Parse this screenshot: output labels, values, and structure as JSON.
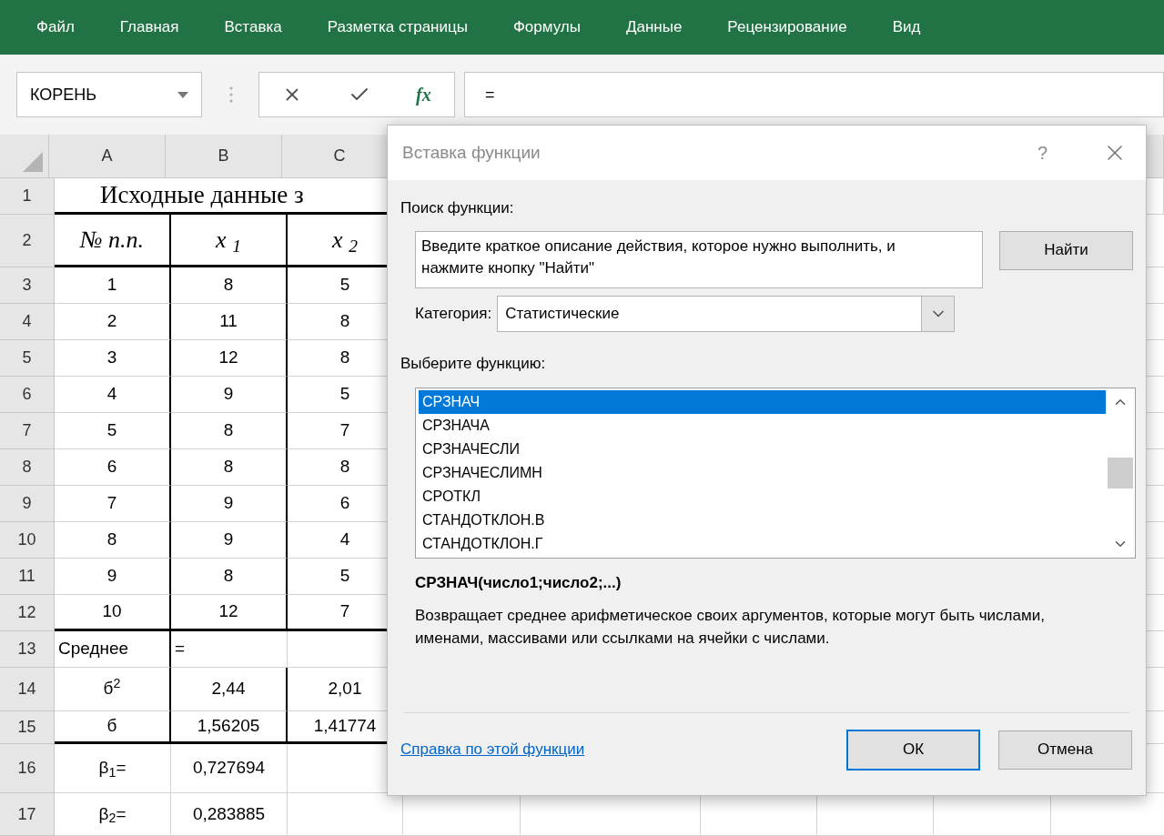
{
  "ribbon_tabs": [
    {
      "label": "Файл"
    },
    {
      "label": "Главная"
    },
    {
      "label": "Вставка"
    },
    {
      "label": "Разметка страницы"
    },
    {
      "label": "Формулы"
    },
    {
      "label": "Данные"
    },
    {
      "label": "Рецензирование"
    },
    {
      "label": "Вид"
    }
  ],
  "formula_bar": {
    "name_box": "КОРЕНЬ",
    "function_button": "fx",
    "formula": "="
  },
  "sheet": {
    "columns": [
      "A",
      "B",
      "C"
    ],
    "rows": [
      {
        "number": "1",
        "kind": "title",
        "title": "Исходные данные з"
      },
      {
        "number": "2",
        "kind": "header",
        "cells": {
          "A": "№ п.п.",
          "B": "x $_{1}$",
          "C": "x $_{2}$"
        }
      },
      {
        "number": "3",
        "kind": "data",
        "cells": {
          "A": "1",
          "B": "8",
          "C": "5"
        }
      },
      {
        "number": "4",
        "kind": "data",
        "cells": {
          "A": "2",
          "B": "11",
          "C": "8"
        }
      },
      {
        "number": "5",
        "kind": "data",
        "cells": {
          "A": "3",
          "B": "12",
          "C": "8"
        }
      },
      {
        "number": "6",
        "kind": "data",
        "cells": {
          "A": "4",
          "B": "9",
          "C": "5"
        }
      },
      {
        "number": "7",
        "kind": "data",
        "cells": {
          "A": "5",
          "B": "8",
          "C": "7"
        }
      },
      {
        "number": "8",
        "kind": "data",
        "cells": {
          "A": "6",
          "B": "8",
          "C": "8"
        }
      },
      {
        "number": "9",
        "kind": "data",
        "cells": {
          "A": "7",
          "B": "9",
          "C": "6"
        }
      },
      {
        "number": "10",
        "kind": "data",
        "cells": {
          "A": "8",
          "B": "9",
          "C": "4"
        }
      },
      {
        "number": "11",
        "kind": "data",
        "cells": {
          "A": "9",
          "B": "8",
          "C": "5"
        }
      },
      {
        "number": "12",
        "kind": "data",
        "cells": {
          "A": "10",
          "B": "12",
          "C": "7"
        }
      },
      {
        "number": "13",
        "kind": "data",
        "cells": {
          "A": "Среднее",
          "B": "="
        }
      },
      {
        "number": "14",
        "kind": "data",
        "cells": {
          "A": "б$^{2}$",
          "B": "2,44",
          "C": "2,01"
        }
      },
      {
        "number": "15",
        "kind": "data",
        "cells": {
          "A": "б",
          "B": "1,56205",
          "C": "1,41774"
        }
      },
      {
        "number": "16",
        "kind": "data",
        "cells": {
          "A": "β$_{1}$=",
          "B": "0,727694"
        }
      },
      {
        "number": "17",
        "kind": "data",
        "cells": {
          "A": "β$_{2}$=",
          "B": "0,283885"
        }
      }
    ]
  },
  "dialog": {
    "title": "Вставка функции",
    "help": "?",
    "search_label": "Поиск функции:",
    "search_value": "Введите краткое описание действия, которое нужно выполнить, и нажмите кнопку \"Найти\"",
    "find_button": "Найти",
    "category_label": "Категория:",
    "category": "Статистические",
    "list_label": "Выберите функцию:",
    "functions": [
      {
        "name": "СРЗНАЧ",
        "selected": true
      },
      {
        "name": "СРЗНАЧА",
        "selected": false
      },
      {
        "name": "СРЗНАЧЕСЛИ",
        "selected": false
      },
      {
        "name": "СРЗНАЧЕСЛИМН",
        "selected": false
      },
      {
        "name": "СРОТКЛ",
        "selected": false
      },
      {
        "name": "СТАНДОТКЛОН.В",
        "selected": false
      },
      {
        "name": "СТАНДОТКЛОН.Г",
        "selected": false
      }
    ],
    "signature": "СРЗНАЧ(число1;число2;...)",
    "description": "Возвращает среднее арифметическое своих аргументов, которые могут быть числами, именами, массивами или ссылками на ячейки с числами.",
    "help_link": "Справка по этой функции",
    "ok_button": "ОК",
    "cancel_button": "Отмена"
  }
}
